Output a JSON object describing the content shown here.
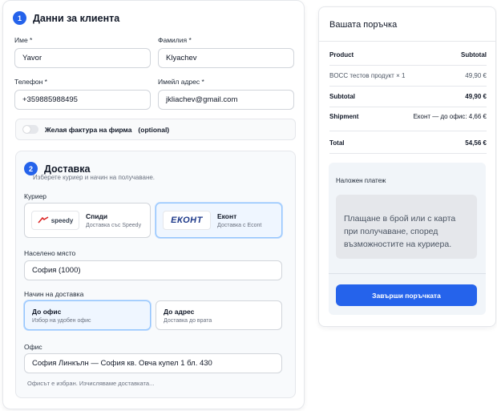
{
  "customer": {
    "step": "1",
    "title": "Данни за клиента",
    "first_name_label": "Име *",
    "first_name_value": "Yavor",
    "last_name_label": "Фамилия *",
    "last_name_value": "Klyachev",
    "phone_label": "Телефон *",
    "phone_value": "+359885988495",
    "email_label": "Имейл адрес *",
    "email_value": "jkliachev@gmail.com",
    "invoice_label": "Желая фактура на фирма",
    "invoice_optional": "(optional)"
  },
  "delivery": {
    "step": "2",
    "title": "Доставка",
    "subtitle": "Изберете куриер и начин на получаване.",
    "courier_label": "Куриер",
    "couriers": [
      {
        "logo": "speedy",
        "name": "Спиди",
        "desc": "Доставка със Speedy"
      },
      {
        "logo": "ЕКОНТ",
        "name": "Еконт",
        "desc": "Доставка с Econt"
      }
    ],
    "city_label": "Населено място",
    "city_value": "София (1000)",
    "method_label": "Начин на доставка",
    "methods": [
      {
        "name": "До офис",
        "desc": "Избор на удобен офис"
      },
      {
        "name": "До адрес",
        "desc": "Доставка до врата"
      }
    ],
    "office_label": "Офис",
    "office_value": "София Линкълн — София кв. Овча купел 1 бл. 430",
    "office_note": "Офисът е избран. Изчисляваме доставката..."
  },
  "order": {
    "title": "Вашата поръчка",
    "product_header": "Product",
    "subtotal_header": "Subtotal",
    "item_name": "BOCC тестов продукт",
    "item_qty": "× 1",
    "item_price": "49,90 €",
    "subtotal_label": "Subtotal",
    "subtotal_value": "49,90 €",
    "shipment_label": "Shipment",
    "shipment_value": "Еконт — до офис: 4,66 €",
    "total_label": "Total",
    "total_value": "54,56 €",
    "payment_title": "Наложен платеж",
    "payment_desc": "Плащане в брой или с карта при получаване, според възможностите на куриера.",
    "finish_button": "Завърши поръчката"
  },
  "colors": {
    "accent": "#2563eb",
    "selected_bg": "#eff6ff"
  }
}
